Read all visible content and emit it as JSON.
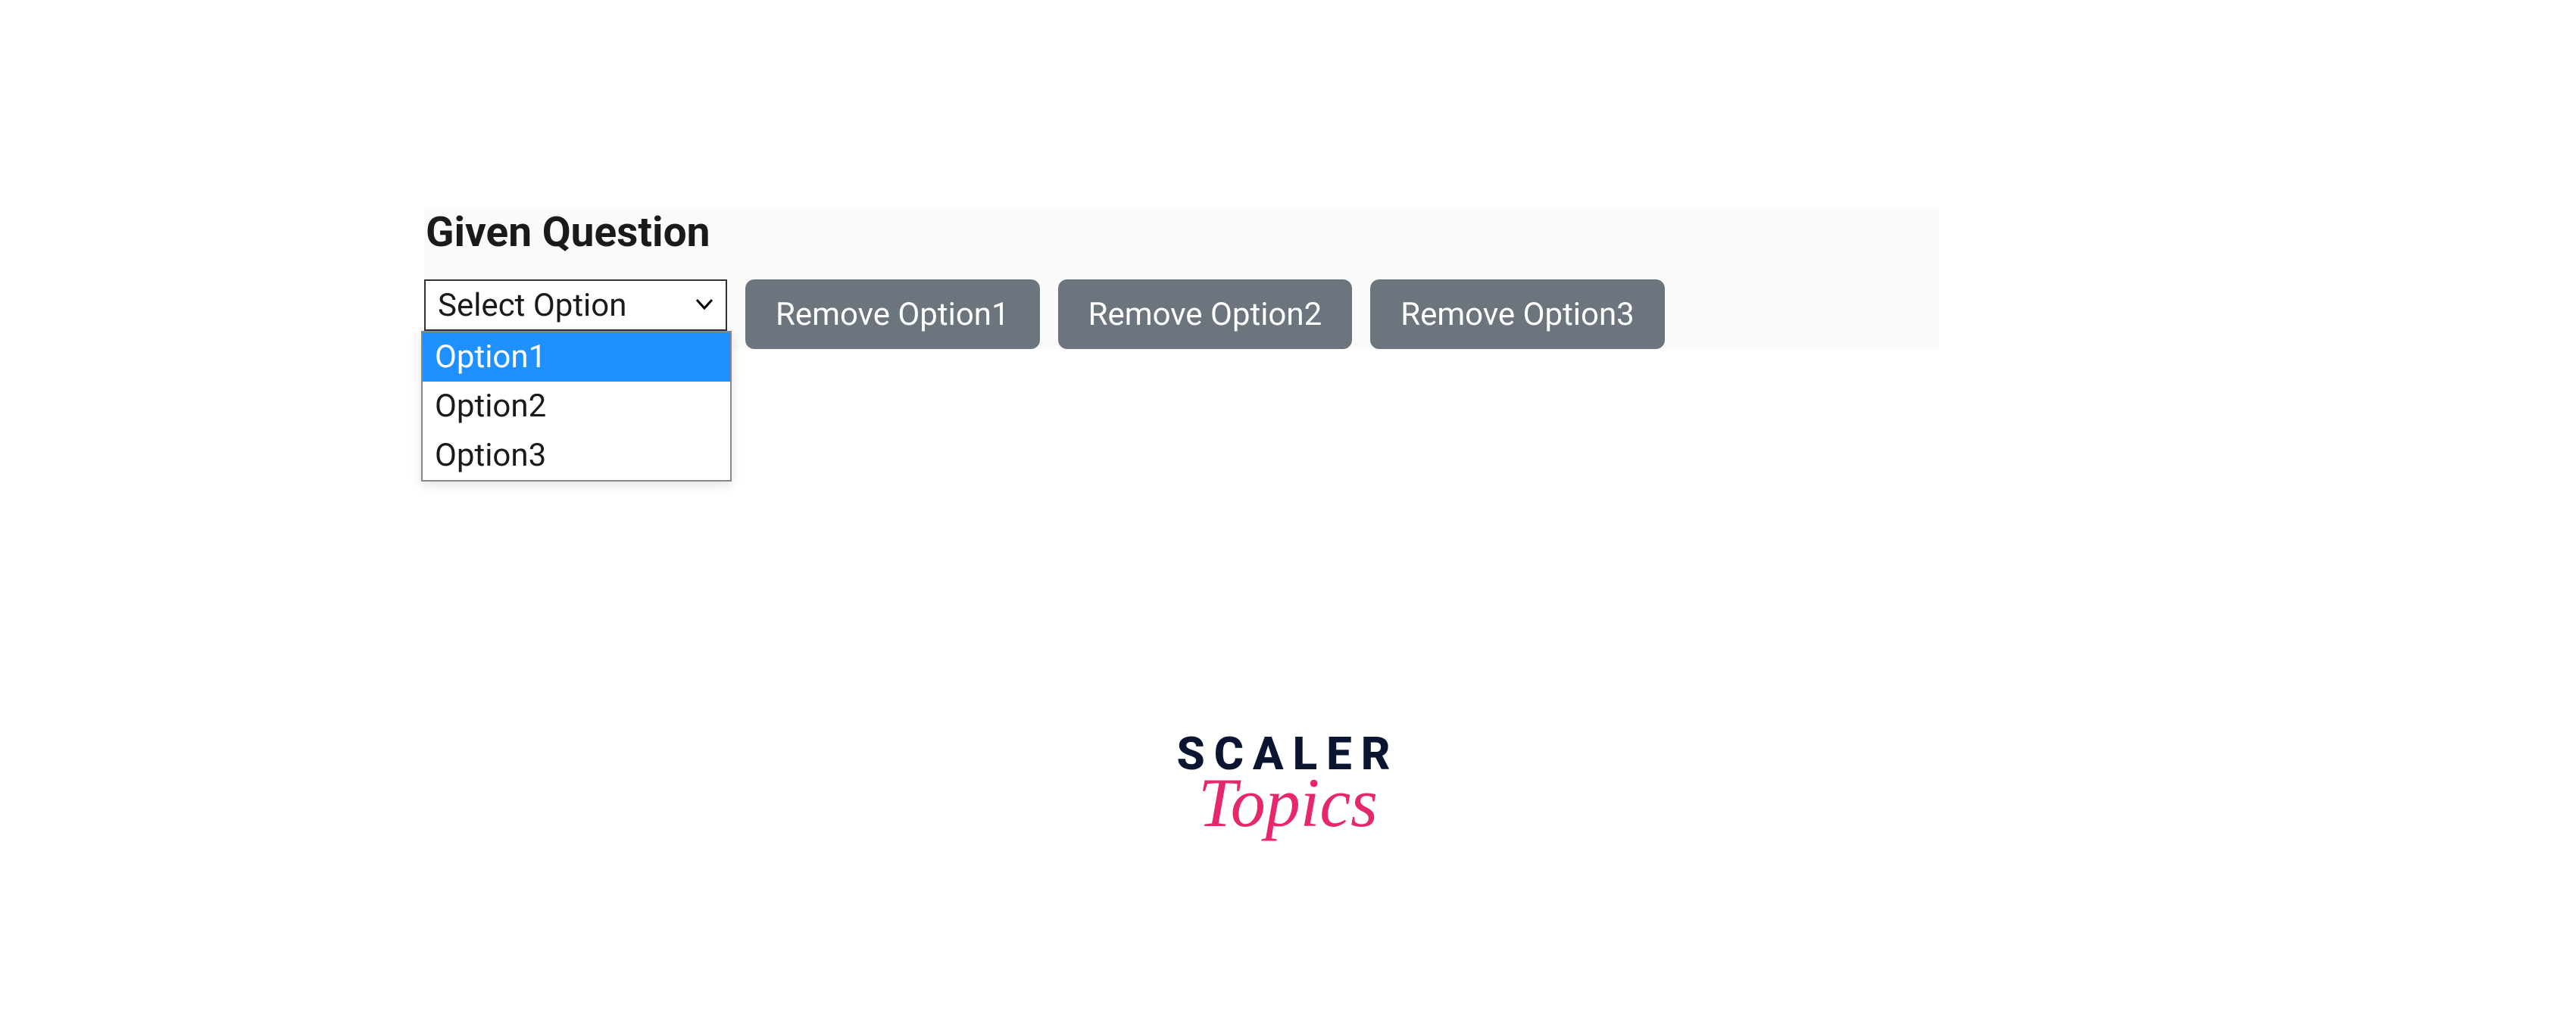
{
  "heading": "Given Question",
  "select": {
    "label": "Select Option",
    "options": [
      {
        "label": "Option1",
        "highlighted": true
      },
      {
        "label": "Option2",
        "highlighted": false
      },
      {
        "label": "Option3",
        "highlighted": false
      }
    ]
  },
  "buttons": [
    {
      "label": "Remove Option1"
    },
    {
      "label": "Remove Option2"
    },
    {
      "label": "Remove Option3"
    }
  ],
  "logo": {
    "line1": "SCALER",
    "line2": "Topics"
  }
}
